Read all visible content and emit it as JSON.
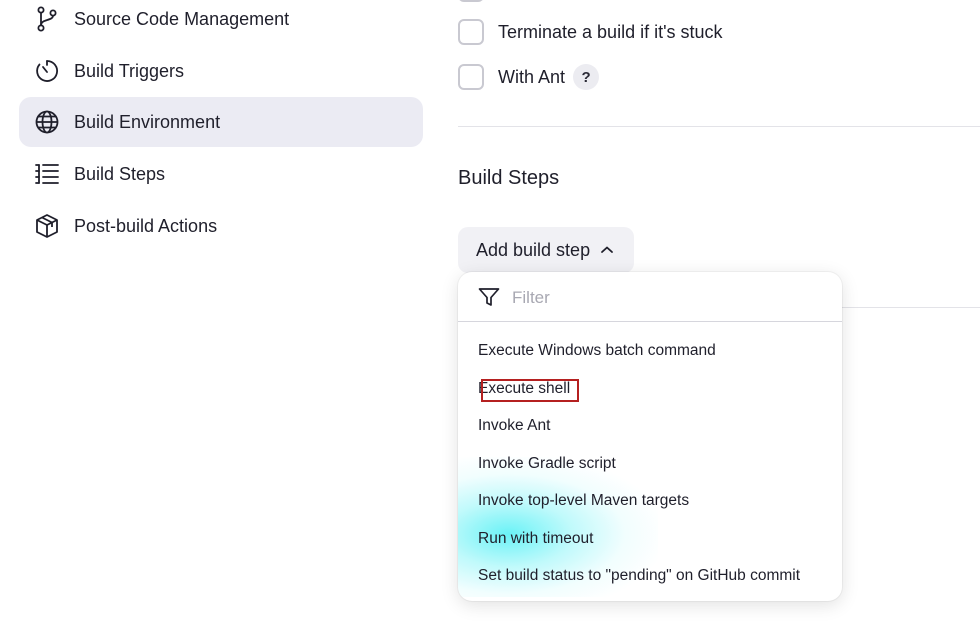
{
  "sidebar": {
    "items": [
      {
        "label": "Source Code Management",
        "icon": "git-branch-icon",
        "active": false
      },
      {
        "label": "Build Triggers",
        "icon": "timer-icon",
        "active": false
      },
      {
        "label": "Build Environment",
        "icon": "globe-icon",
        "active": true
      },
      {
        "label": "Build Steps",
        "icon": "list-icon",
        "active": false
      },
      {
        "label": "Post-build Actions",
        "icon": "package-icon",
        "active": false
      }
    ]
  },
  "options": {
    "terminate_stuck": {
      "label": "Terminate a build if it's stuck",
      "checked": false
    },
    "with_ant": {
      "label": "With Ant",
      "checked": false,
      "help": "?"
    }
  },
  "build_steps": {
    "title": "Build Steps",
    "add_button_label": "Add build step"
  },
  "dropdown": {
    "filter_placeholder": "Filter",
    "items": [
      "Execute Windows batch command",
      "Execute shell",
      "Invoke Ant",
      "Invoke Gradle script",
      "Invoke top-level Maven targets",
      "Run with timeout",
      "Set build status to \"pending\" on GitHub commit"
    ],
    "highlighted_item": "Execute shell"
  },
  "colors": {
    "active_bg": "#ebebf3",
    "highlight_border": "#b52020",
    "glow": "#50f0f5"
  }
}
